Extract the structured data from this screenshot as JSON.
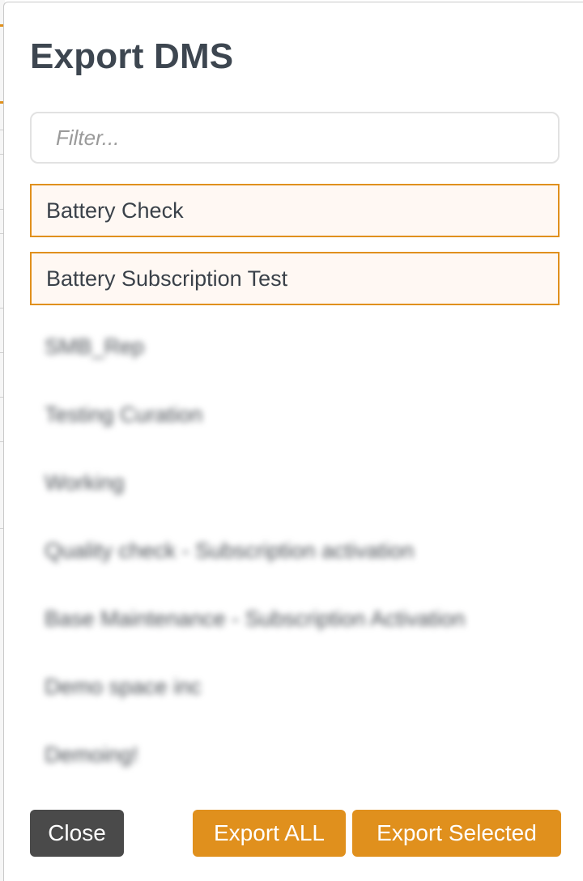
{
  "modal": {
    "title": "Export DMS",
    "filter": {
      "placeholder": "Filter...",
      "value": ""
    },
    "items": [
      {
        "label": "Battery Check",
        "selected": true,
        "blurred": false
      },
      {
        "label": "Battery Subscription Test",
        "selected": true,
        "blurred": false
      },
      {
        "label": "SMB_Rep",
        "selected": false,
        "blurred": true
      },
      {
        "label": "Testing Curation",
        "selected": false,
        "blurred": true
      },
      {
        "label": "Working",
        "selected": false,
        "blurred": true
      },
      {
        "label": "Quality check - Subscription activation",
        "selected": false,
        "blurred": true
      },
      {
        "label": "Base Maintenance - Subscription Activation",
        "selected": false,
        "blurred": true
      },
      {
        "label": "Demo space inc",
        "selected": false,
        "blurred": true
      },
      {
        "label": "Demoing!",
        "selected": false,
        "blurred": true
      }
    ],
    "buttons": {
      "close": "Close",
      "export_all": "Export ALL",
      "export_selected": "Export Selected"
    }
  },
  "colors": {
    "accent": "#e0901d",
    "close_button": "#4a4a4a",
    "title": "#3d4650",
    "selected_bg": "#fff8f3"
  }
}
